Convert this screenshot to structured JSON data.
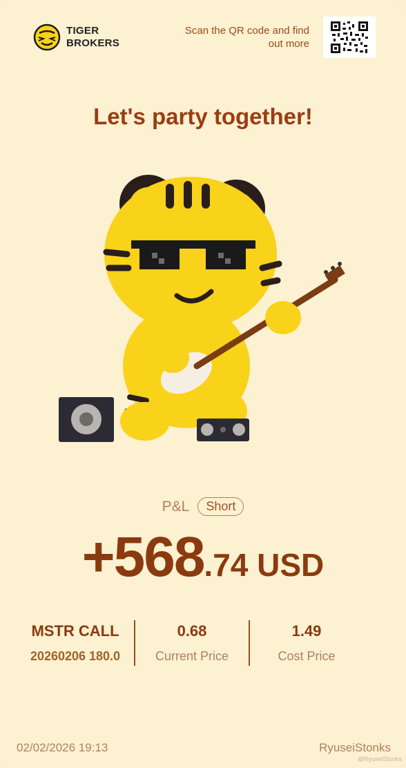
{
  "header": {
    "brand_line1": "TIGER",
    "brand_line2": "BROKERS",
    "scan_text": "Scan the QR code and find out more"
  },
  "headline": "Let's party together!",
  "pnl": {
    "label": "P&L",
    "badge": "Short",
    "amount_big": "+568",
    "amount_small": ".74 USD"
  },
  "stats": {
    "instrument": "MSTR CALL",
    "contract": "20260206 180.0",
    "current_price": "0.68",
    "current_price_label": "Current Price",
    "cost_price": "1.49",
    "cost_price_label": "Cost Price"
  },
  "footer": {
    "datetime": "02/02/2026 19:13",
    "username": "RyuseiStonks",
    "watermark": "@RyuseiStonks"
  },
  "icons": {
    "logo": "tiger-logo-icon",
    "qr": "qr-code-icon",
    "mascot": "tiger-guitar-mascot"
  },
  "colors": {
    "background": "#fcf1d1",
    "accent": "#8b3a0f",
    "muted": "#b08060",
    "tiger_yellow": "#f9d21a"
  }
}
